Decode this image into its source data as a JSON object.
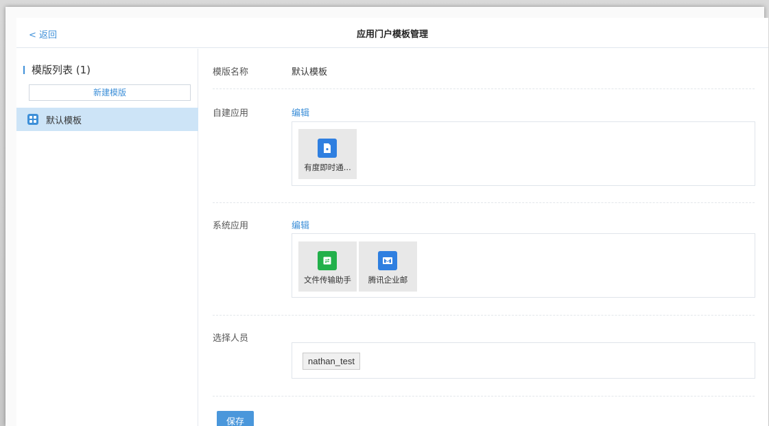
{
  "header": {
    "back_label": "< 返回",
    "title": "应用门户模板管理"
  },
  "sidebar": {
    "heading": "模版列表 (1)",
    "new_button": "新建模版",
    "items": [
      {
        "label": "默认模板",
        "icon": "grid-icon"
      }
    ]
  },
  "main": {
    "name_row": {
      "label": "模版名称",
      "value": "默认模板"
    },
    "custom_apps": {
      "label": "自建应用",
      "edit": "编辑",
      "apps": [
        {
          "name": "有度即时通...",
          "icon": "document-icon",
          "color": "#2f7fe0"
        }
      ]
    },
    "system_apps": {
      "label": "系统应用",
      "edit": "编辑",
      "apps": [
        {
          "name": "文件传输助手",
          "icon": "file-transfer-icon",
          "color": "#22b04a"
        },
        {
          "name": "腾讯企业邮",
          "icon": "mail-icon",
          "color": "#2f7fe0"
        }
      ]
    },
    "people": {
      "label": "选择人员",
      "selected": [
        "nathan_test"
      ]
    },
    "save_label": "保存"
  },
  "colors": {
    "accent": "#3d8fd8",
    "selected_bg": "#cde4f7",
    "save_button": "#4a97db"
  }
}
